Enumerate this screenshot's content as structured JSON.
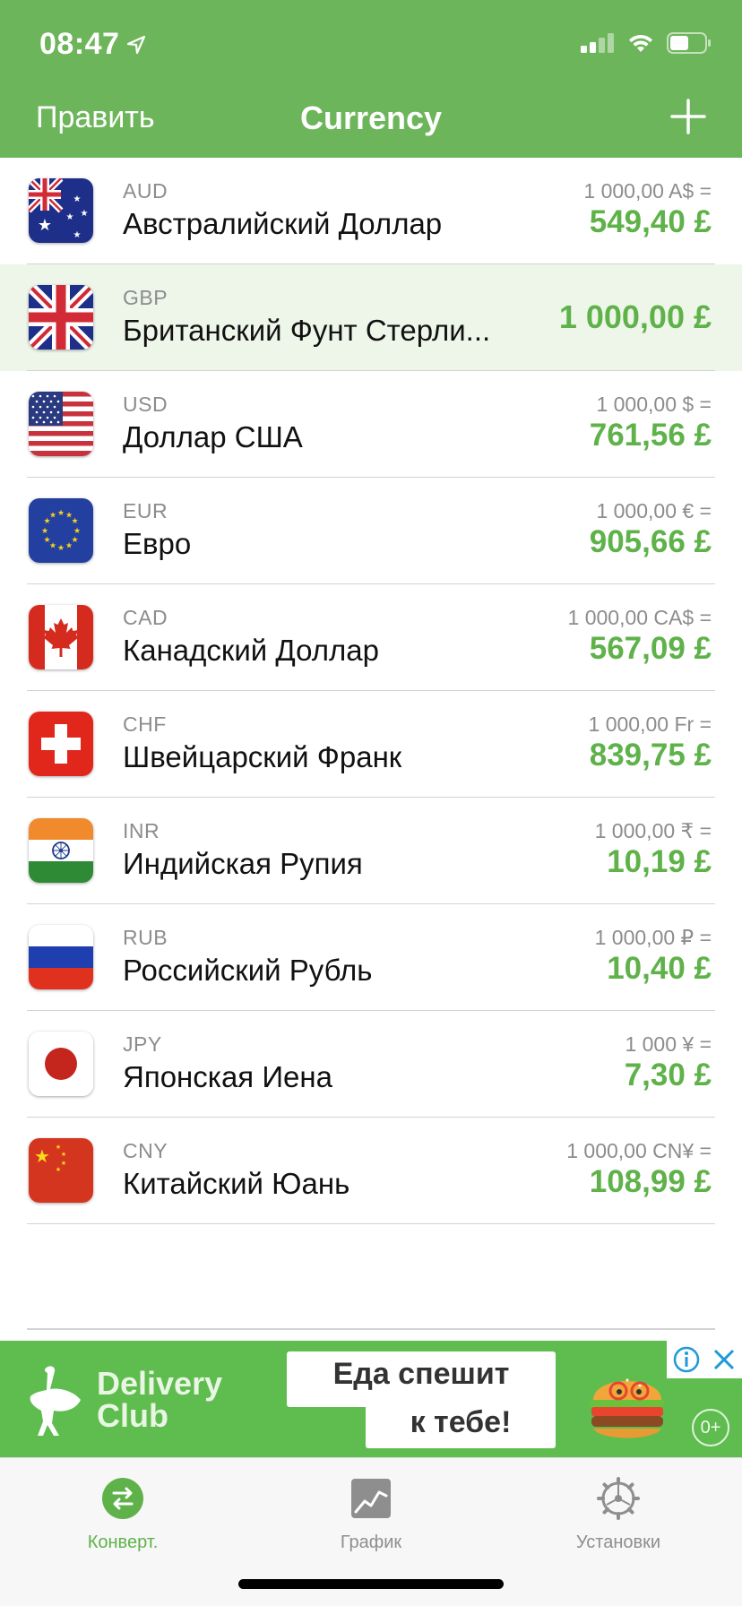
{
  "status": {
    "time": "08:47"
  },
  "nav": {
    "edit": "Править",
    "title": "Currency"
  },
  "currencies": [
    {
      "code": "AUD",
      "name": "Австралийский Доллар",
      "base": "1 000,00 A$ =",
      "converted": "549,40 £",
      "flag": "australia-flag-icon"
    },
    {
      "code": "GBP",
      "name": "Британский Фунт Стерли...",
      "base": "",
      "converted": "1 000,00 £",
      "flag": "uk-flag-icon",
      "selected": true
    },
    {
      "code": "USD",
      "name": "Доллар США",
      "base": "1 000,00 $ =",
      "converted": "761,56 £",
      "flag": "usa-flag-icon"
    },
    {
      "code": "EUR",
      "name": "Евро",
      "base": "1 000,00 € =",
      "converted": "905,66 £",
      "flag": "eu-flag-icon"
    },
    {
      "code": "CAD",
      "name": "Канадский Доллар",
      "base": "1 000,00 CA$ =",
      "converted": "567,09 £",
      "flag": "canada-flag-icon"
    },
    {
      "code": "CHF",
      "name": "Швейцарский Франк",
      "base": "1 000,00 Fr =",
      "converted": "839,75 £",
      "flag": "switzerland-flag-icon"
    },
    {
      "code": "INR",
      "name": "Индийская Рупия",
      "base": "1 000,00 ₹ =",
      "converted": "10,19 £",
      "flag": "india-flag-icon"
    },
    {
      "code": "RUB",
      "name": "Российский Рубль",
      "base": "1 000,00 ₽ =",
      "converted": "10,40 £",
      "flag": "russia-flag-icon"
    },
    {
      "code": "JPY",
      "name": "Японская Иена",
      "base": "1 000 ¥ =",
      "converted": "7,30 £",
      "flag": "japan-flag-icon"
    },
    {
      "code": "CNY",
      "name": "Китайский Юань",
      "base": "1 000,00 CN¥ =",
      "converted": "108,99 £",
      "flag": "china-flag-icon"
    }
  ],
  "ad": {
    "brand_line1": "Delivery",
    "brand_line2": "Club",
    "text_line1": "Еда спешит",
    "text_line2": "к тебе!",
    "badge": "0+"
  },
  "tabs": [
    {
      "label": "Конверт.",
      "icon": "convert-icon",
      "active": true
    },
    {
      "label": "График",
      "icon": "chart-icon",
      "active": false
    },
    {
      "label": "Установки",
      "icon": "settings-gear-icon",
      "active": false
    }
  ],
  "colors": {
    "accent": "#6db55a",
    "value_green": "#5fb24a",
    "selected_row": "#eef6ea"
  }
}
